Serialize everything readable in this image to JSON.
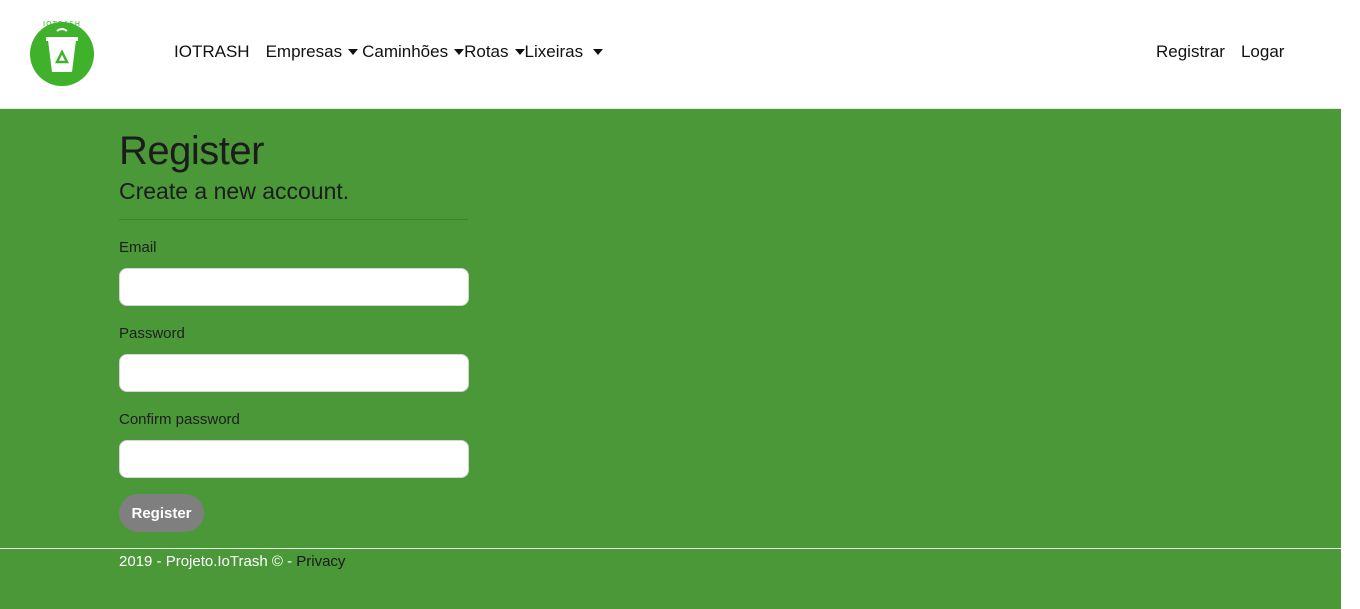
{
  "brand": {
    "logo_text": "IOTRASH"
  },
  "nav": {
    "brand_link": "IOTRASH",
    "items": [
      {
        "label": "Empresas"
      },
      {
        "label": "Caminhões"
      },
      {
        "label": "Rotas"
      },
      {
        "label": "Lixeiras"
      }
    ],
    "right": {
      "register": "Registrar",
      "login": "Logar"
    }
  },
  "page": {
    "title": "Register",
    "subtitle": "Create a new account."
  },
  "form": {
    "email_label": "Email",
    "email_value": "",
    "password_label": "Password",
    "password_value": "",
    "confirm_label": "Confirm password",
    "confirm_value": "",
    "submit_label": "Register"
  },
  "footer": {
    "text": "2019 - Projeto.IoTrash © - ",
    "privacy_link": "Privacy"
  },
  "colors": {
    "main_bg": "#4a9838",
    "logo_green": "#3fb12b",
    "button_bg": "#7f7f7f"
  }
}
